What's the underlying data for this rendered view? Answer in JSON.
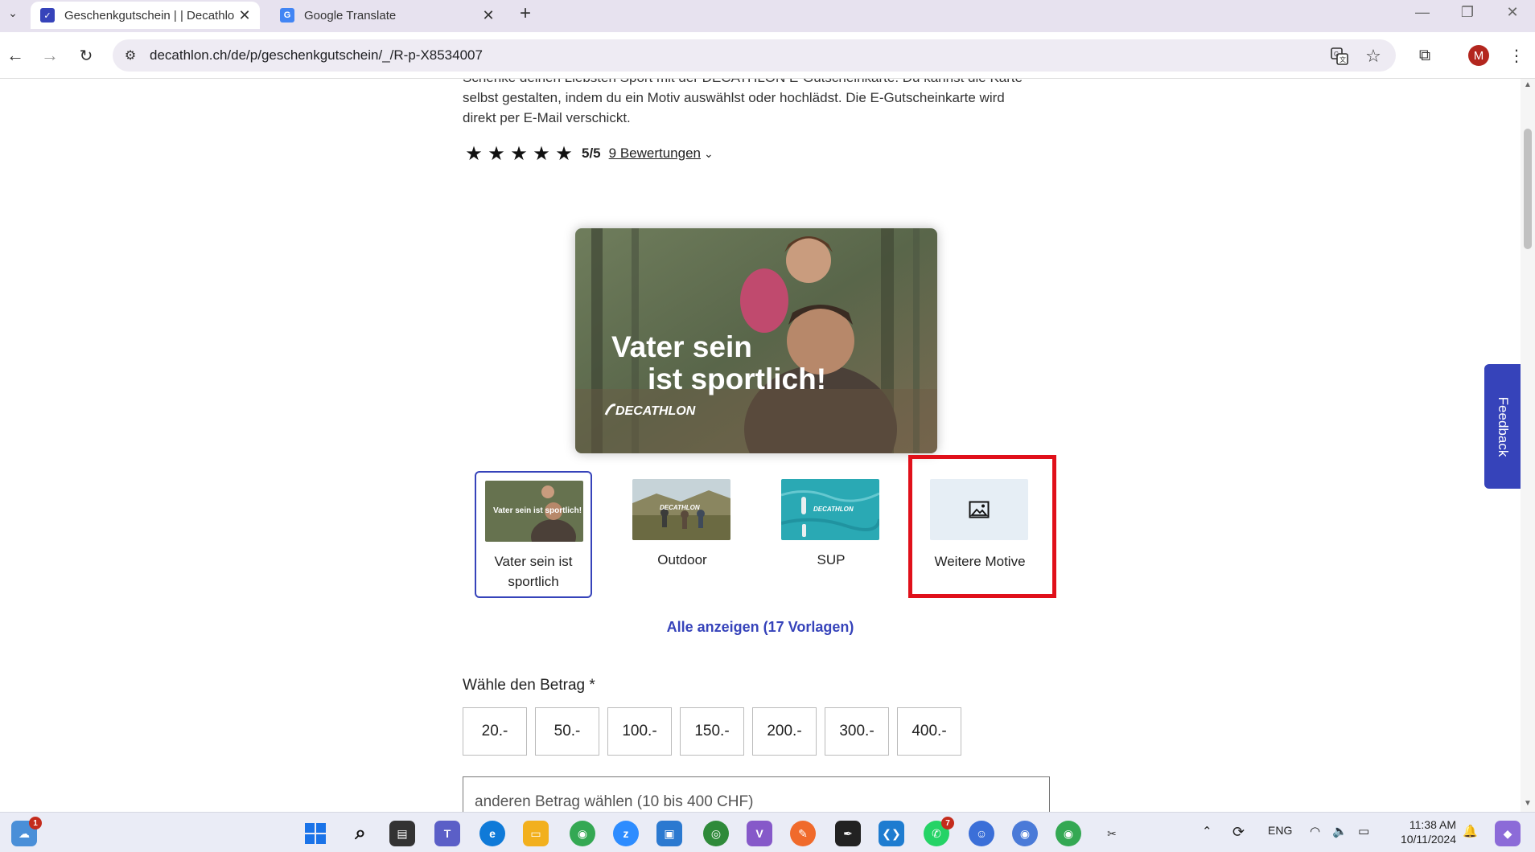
{
  "browser": {
    "tabs": [
      {
        "title": "Geschenkgutschein | | Decathlo",
        "favicon": "decathlon-favicon-icon",
        "active": true
      },
      {
        "title": "Google Translate",
        "favicon": "google-translate-favicon-icon",
        "active": false
      }
    ],
    "new_tab": "+",
    "url": "decathlon.ch/de/p/geschenkgutschein/_/R-p-X8534007",
    "profile_initial": "M"
  },
  "page": {
    "intro_text": "Schenke deinen Liebsten Sport mit der DECATHLON E-Gutscheinkarte. Du kannst die Karte selbst gestalten, indem du ein Motiv auswählst oder hochlädst. Die E-Gutscheinkarte wird direkt per E-Mail verschickt.",
    "rating": {
      "stars": 5,
      "score": "5/5",
      "reviews_link": "9 Bewertungen"
    },
    "hero": {
      "line1": "Vater sein",
      "line2": "ist sportlich!",
      "brand": "DECATHLON"
    },
    "designs": [
      {
        "label": "Vater sein ist sportlich",
        "selected": true
      },
      {
        "label": "Outdoor",
        "selected": false
      },
      {
        "label": "SUP",
        "selected": false
      },
      {
        "label": "Weitere Motive",
        "selected": false
      }
    ],
    "thumb_brand": "DECATHLON",
    "thumb_text": "Vater sein ist sportlich!",
    "show_all_link": "Alle anzeigen (17 Vorlagen)",
    "amount_title": "Wähle den Betrag *",
    "amounts": [
      "20.-",
      "50.-",
      "100.-",
      "150.-",
      "200.-",
      "300.-",
      "400.-"
    ],
    "other_amount_placeholder": "anderen Betrag wählen (10 bis 400 CHF)",
    "feedback_label": "Feedback"
  },
  "taskbar": {
    "weather_badge": "1",
    "teams_badge": "7",
    "language": "ENG",
    "time": "11:38 AM",
    "date": "10/11/2024"
  },
  "colors": {
    "accent": "#3643ba",
    "highlight_box": "#e0101a",
    "tabstrip": "#e7e2ef"
  }
}
